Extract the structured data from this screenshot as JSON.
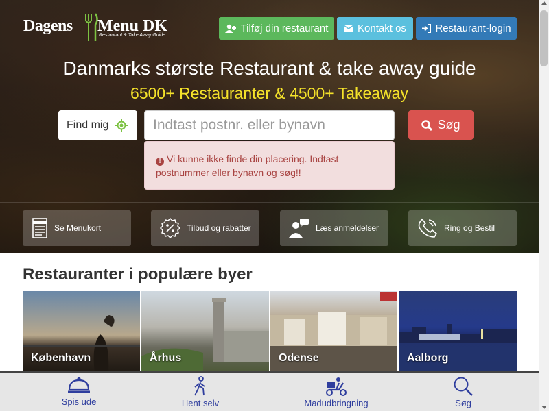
{
  "logo": {
    "part1": "Dagens",
    "part2": "Menu DK",
    "tagline": "Restaurant & Take Away Guide"
  },
  "header_buttons": {
    "add_restaurant": "Tilføj din restaurant",
    "contact": "Kontakt os",
    "login": "Restaurant-login"
  },
  "hero": {
    "headline": "Danmarks største Restaurant & take away guide",
    "subline": "6500+ Restauranter & 4500+ Takeaway"
  },
  "search": {
    "find_me": "Find mig",
    "placeholder": "Indtast postnr. eller bynavn",
    "button": "Søg",
    "error": "Vi kunne ikke finde din placering. Indtast postnummer eller bynavn og søg!!"
  },
  "features": [
    {
      "label": "Se Menukort",
      "icon": "menu-card-icon"
    },
    {
      "label": "Tilbud og rabatter",
      "icon": "percent-badge-icon"
    },
    {
      "label": "Læs anmeldelser",
      "icon": "reviews-icon"
    },
    {
      "label": "Ring og Bestil",
      "icon": "phone-icon"
    }
  ],
  "cities_section": {
    "title": "Restauranter i populære byer",
    "cities": [
      "København",
      "Århus",
      "Odense",
      "Aalborg"
    ]
  },
  "bottom_nav": [
    {
      "label": "Spis ude",
      "icon": "cloche-icon"
    },
    {
      "label": "Hent selv",
      "icon": "walking-person-icon"
    },
    {
      "label": "Madudbringning",
      "icon": "delivery-scooter-icon"
    },
    {
      "label": "Søg",
      "icon": "search-icon"
    }
  ],
  "colors": {
    "green": "#5cb85c",
    "info": "#5bc0de",
    "primary": "#337ab7",
    "danger": "#d9534f",
    "subline": "#f5e22a",
    "nav": "#2f3e9e"
  }
}
